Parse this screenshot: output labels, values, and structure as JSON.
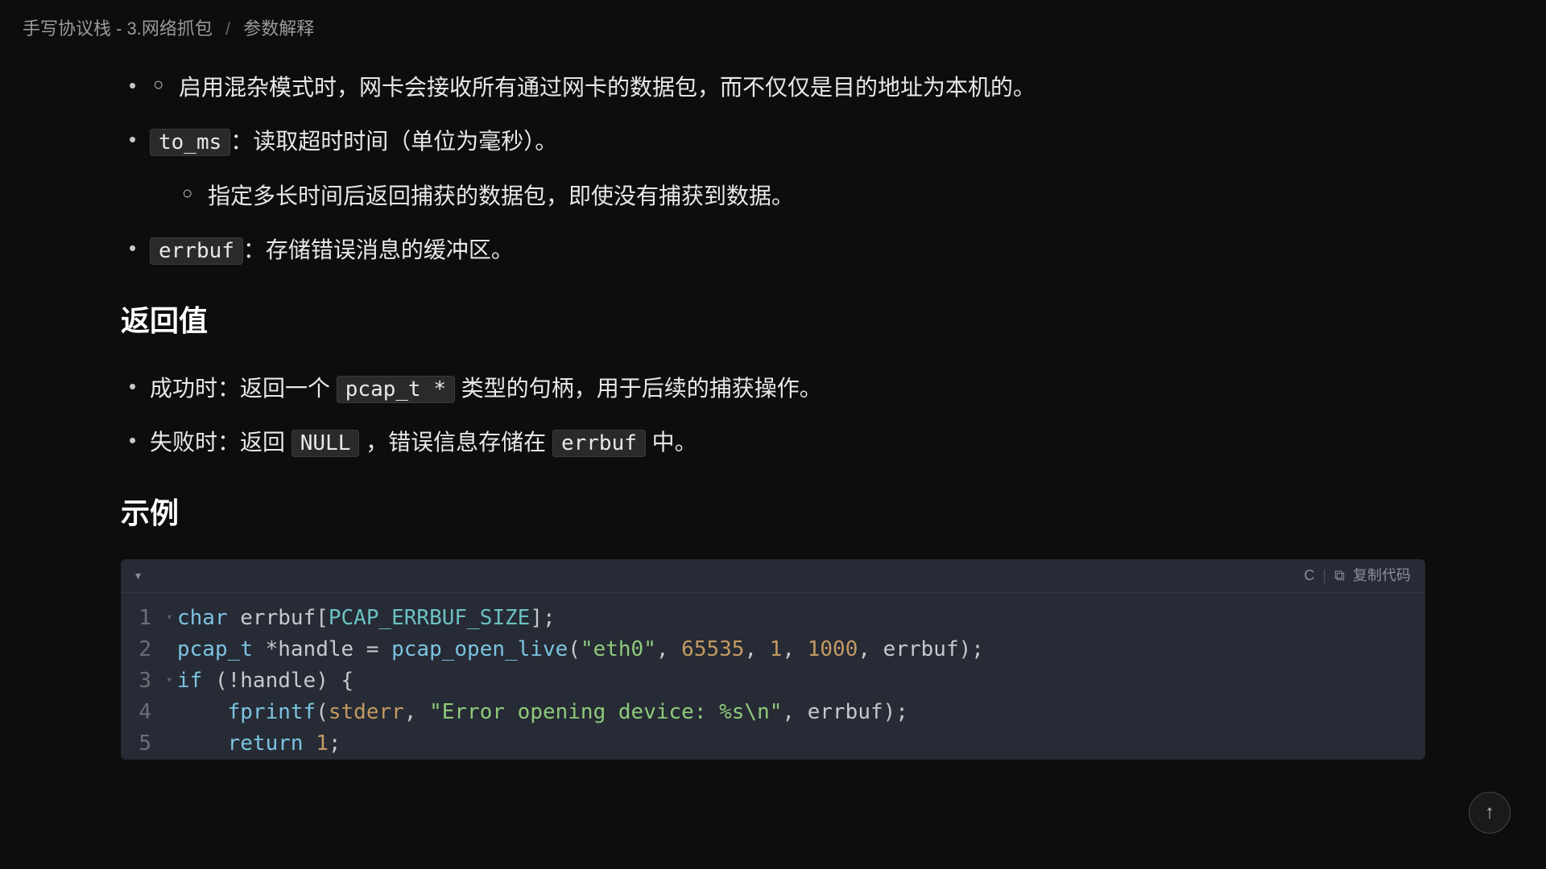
{
  "breadcrumb": {
    "part1": "手写协议栈 - 3.网络抓包",
    "sep": "/",
    "part2": "参数解释"
  },
  "bullets": {
    "promisc_sub": "启用混杂模式时，网卡会接收所有通过网卡的数据包，而不仅仅是目的地址为本机的。",
    "to_ms_code": "to_ms",
    "to_ms_text": "：读取超时时间（单位为毫秒）。",
    "to_ms_sub": "指定多长时间后返回捕获的数据包，即使没有捕获到数据。",
    "errbuf_code": "errbuf",
    "errbuf_text": "：存储错误消息的缓冲区。"
  },
  "sections": {
    "return_title": "返回值",
    "ret_success_prefix": "成功时：返回一个 ",
    "ret_success_code": "pcap_t *",
    "ret_success_suffix": " 类型的句柄，用于后续的捕获操作。",
    "ret_fail_prefix": "失败时：返回 ",
    "ret_fail_code1": "NULL",
    "ret_fail_mid": " ，错误信息存储在 ",
    "ret_fail_code2": "errbuf",
    "ret_fail_suffix": " 中。",
    "example_title": "示例"
  },
  "codeblock": {
    "lang": "C",
    "copy_label": "复制代码",
    "lines": {
      "l1": {
        "n": "1",
        "type": "char",
        "ident": " errbuf",
        "punc1": "[",
        "const": "PCAP_ERRBUF_SIZE",
        "punc2": "];"
      },
      "l2": {
        "n": "2",
        "type": "pcap_t",
        "star": " *",
        "ident": "handle",
        "eq": " = ",
        "func": "pcap_open_live",
        "open": "(",
        "str": "\"eth0\"",
        "c1": ", ",
        "n1": "65535",
        "c2": ", ",
        "n2": "1",
        "c3": ", ",
        "n3": "1000",
        "c4": ", ",
        "arg": "errbuf",
        "close": ");"
      },
      "l3": {
        "n": "3",
        "kw": "if",
        "space": " ",
        "open": "(",
        "not": "!",
        "ident": "handle",
        "close": ")",
        "brace": " {"
      },
      "l4": {
        "n": "4",
        "indent": "    ",
        "func": "fprintf",
        "open": "(",
        "arg1": "stderr",
        "c1": ", ",
        "str": "\"Error opening device: %s\\n\"",
        "c2": ", ",
        "arg2": "errbuf",
        "close": ");"
      },
      "l5": {
        "n": "5",
        "indent": "    ",
        "kw": "return",
        "space": " ",
        "num": "1",
        "semi": ";"
      }
    }
  },
  "scrolltop_glyph": "↑"
}
